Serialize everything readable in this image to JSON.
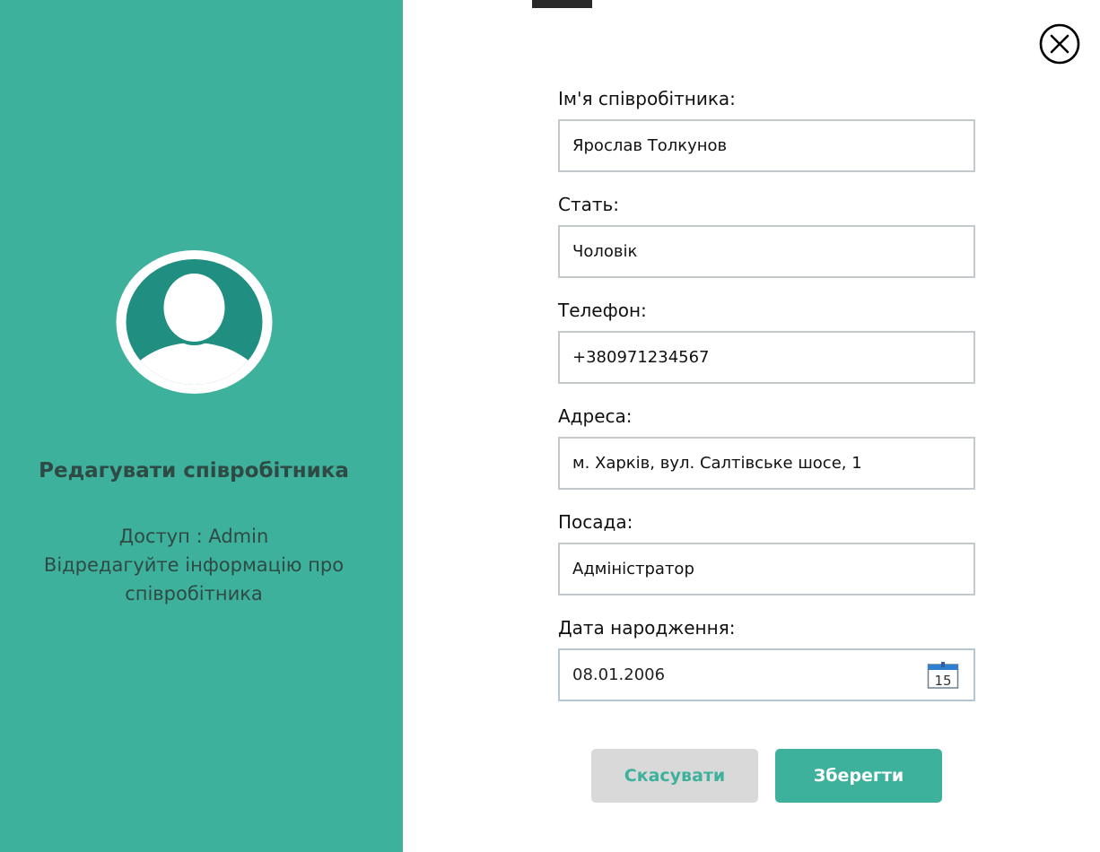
{
  "sidebar": {
    "title": "Редагувати співробітника",
    "access_text": "Доступ : Admin",
    "description_line1": "Відредагуйте інформацію про",
    "description_line2": "співробітника",
    "avatar_icon": "user-avatar-icon"
  },
  "form": {
    "name": {
      "label": "Ім'я співробітника:",
      "value": "Ярослав Толкунов"
    },
    "gender": {
      "label": "Стать:",
      "value": "Чоловік"
    },
    "phone": {
      "label": "Телефон:",
      "value": "+380971234567"
    },
    "address": {
      "label": "Адреса:",
      "value": "м. Харків, вул. Салтівське шосе, 1"
    },
    "position": {
      "label": "Посада:",
      "value": "Адміністратор"
    },
    "birthdate": {
      "label": "Дата народження:",
      "value": "08.01.2006",
      "calendar_day": "15"
    }
  },
  "buttons": {
    "cancel_label": "Скасувати",
    "save_label": "Зберегти"
  },
  "colors": {
    "accent": "#3eb19c",
    "accent_dark": "#208f81",
    "cancel_bg": "#d9d9d9"
  }
}
